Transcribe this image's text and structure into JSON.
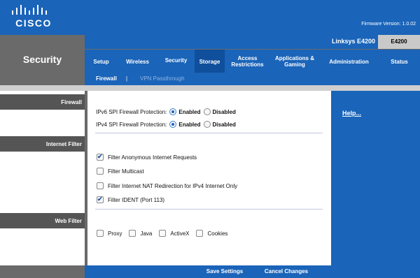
{
  "brand": {
    "logo_text": "CISCO"
  },
  "header": {
    "firmware": "Firmware Version: 1.0.02",
    "product_name": "Linksys E4200",
    "model": "E4200"
  },
  "page": {
    "section_title": "Security"
  },
  "tabs": [
    {
      "line1": "Setup",
      "line2": ""
    },
    {
      "line1": "Wireless",
      "line2": ""
    },
    {
      "line1": "Security",
      "line2": ""
    },
    {
      "line1": "Storage",
      "line2": ""
    },
    {
      "line1": "Access",
      "line2": "Restrictions"
    },
    {
      "line1": "Applications &",
      "line2": "Gaming"
    },
    {
      "line1": "Administration",
      "line2": ""
    },
    {
      "line1": "Status",
      "line2": ""
    }
  ],
  "active_tab": "Security",
  "subtabs": {
    "firewall": "Firewall",
    "separator": "|",
    "vpn": "VPN Passthrough"
  },
  "left_sections": {
    "firewall": "Firewall",
    "internet_filter": "Internet Filter",
    "web_filter": "Web Filter"
  },
  "firewall": {
    "ipv6_label": "IPv6 SPI Firewall  Protection:",
    "ipv4_label": "IPv4 SPI Firewall Protection:",
    "enabled": "Enabled",
    "disabled": "Disabled",
    "ipv6_value": "Enabled",
    "ipv4_value": "Enabled"
  },
  "internet_filter": {
    "anonymous": {
      "label": "Filter Anonymous Internet Requests",
      "checked": true
    },
    "multicast": {
      "label": "Filter Multicast",
      "checked": false
    },
    "nat": {
      "label": "Filter Internet NAT Redirection for IPv4 Internet Only",
      "checked": false
    },
    "ident": {
      "label": "Filter IDENT (Port 113)",
      "checked": true
    }
  },
  "web_filter": {
    "proxy": {
      "label": "Proxy",
      "checked": false
    },
    "java": {
      "label": "Java",
      "checked": false
    },
    "activex": {
      "label": "ActiveX",
      "checked": false
    },
    "cookies": {
      "label": "Cookies",
      "checked": false
    }
  },
  "help": {
    "link": "Help..."
  },
  "buttons": {
    "save": "Save Settings",
    "cancel": "Cancel Changes"
  },
  "colors": {
    "brand_blue": "#1a64b9",
    "gray": "#6a6a6a"
  }
}
